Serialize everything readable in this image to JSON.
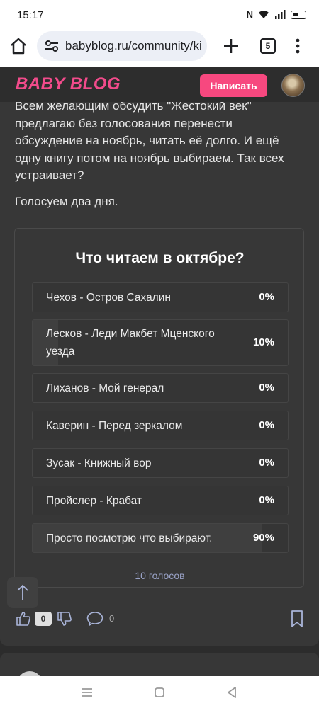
{
  "status": {
    "time": "15:17"
  },
  "browser": {
    "url": "babyblog.ru/community/ki",
    "tab_count": "5"
  },
  "header": {
    "logo": "BABY BLOG",
    "write_label": "Написать"
  },
  "post": {
    "paragraph1": "Всем желающим обсудить \"Жестокий век\" предлагаю без голосования перенести обсуждение на ноябрь, читать её долго. И ещё одну книгу потом на ноябрь выбираем. Так всех устраивает?",
    "paragraph2": "Голосуем два дня."
  },
  "poll": {
    "title": "Что читаем в октябре?",
    "options": [
      {
        "label": "Чехов - Остров Сахалин",
        "percent": "0%",
        "value": 0
      },
      {
        "label": "Лесков - Леди Макбет Мценского уезда",
        "percent": "10%",
        "value": 10
      },
      {
        "label": "Лиханов - Мой генерал",
        "percent": "0%",
        "value": 0
      },
      {
        "label": "Каверин - Перед зеркалом",
        "percent": "0%",
        "value": 0
      },
      {
        "label": "Зусак - Книжный вор",
        "percent": "0%",
        "value": 0
      },
      {
        "label": "Пройслер - Крабат",
        "percent": "0%",
        "value": 0
      },
      {
        "label": "Просто посмотрю что выбирают.",
        "percent": "90%",
        "value": 90
      }
    ],
    "votes": "10 голосов"
  },
  "actions": {
    "likes": "0",
    "comments": "0"
  },
  "colors": {
    "brand": "#f24b8b",
    "button": "#f7487f",
    "card": "#373737",
    "background": "#2c2c2c"
  }
}
